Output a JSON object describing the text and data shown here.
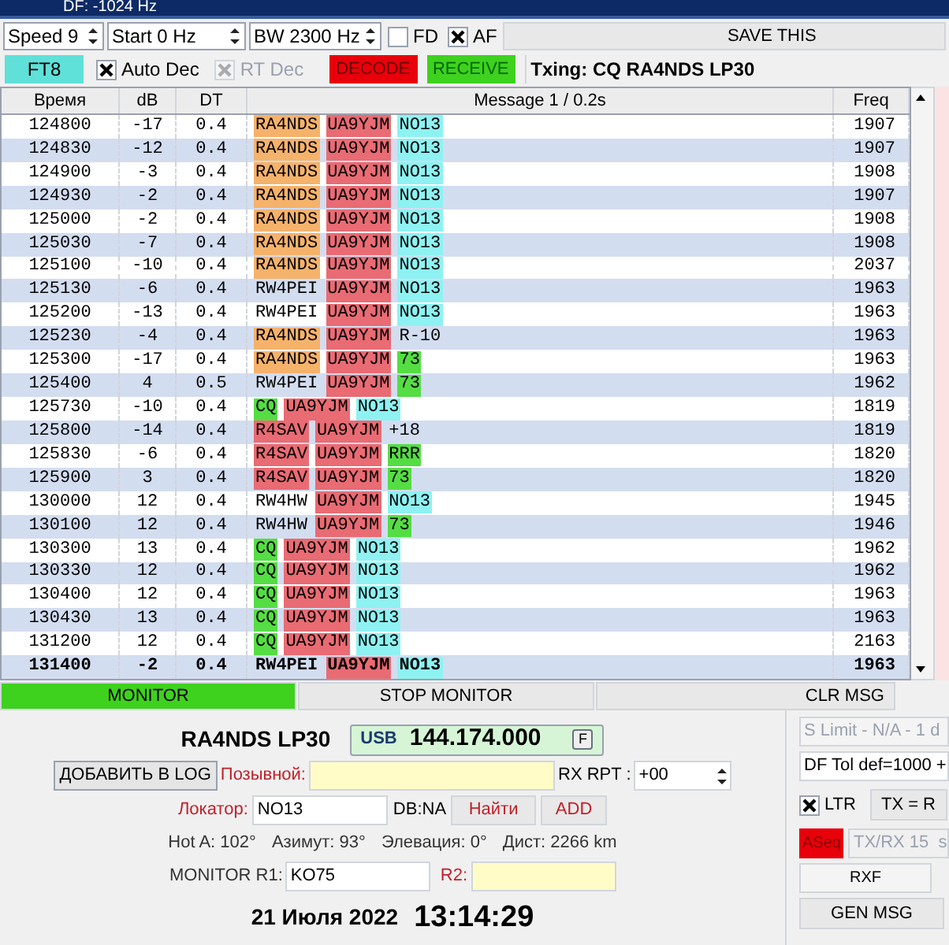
{
  "top_bar": {
    "readout": "DF: -1024 Hz"
  },
  "toolbar": {
    "spinners": [
      "Speed 9",
      "Start 0 Hz",
      "BW 2300 Hz"
    ],
    "checks": [
      {
        "label": "FD",
        "checked": false
      },
      {
        "label": "AF",
        "checked": true
      }
    ],
    "save_button": "SAVE THIS"
  },
  "mode_bar": {
    "mode_button": "FT8",
    "checks": [
      {
        "label": "Auto Dec",
        "checked": true,
        "disabled": false
      },
      {
        "label": "RT Dec",
        "checked": true,
        "disabled": true
      }
    ],
    "decode_button": "DECODE",
    "receive_button": "RECEIVE",
    "txing": "Txing: CQ RA4NDS LP30"
  },
  "table": {
    "columns": [
      "Время",
      "dB",
      "DT",
      "Message 1 / 0.2s",
      "Freq"
    ],
    "rows": [
      {
        "time": "124800",
        "db": "-17",
        "dt": "0.4",
        "message": [
          {
            "text": "RA4NDS",
            "color": "#f5b26b"
          },
          {
            "text": "UA9YJM",
            "color": "#e96b73"
          },
          {
            "text": "NO13",
            "color": "#8ef2f2"
          }
        ],
        "freq": "1907",
        "selected": false
      },
      {
        "time": "124830",
        "db": "-12",
        "dt": "0.4",
        "message": [
          {
            "text": "RA4NDS",
            "color": "#f5b26b"
          },
          {
            "text": "UA9YJM",
            "color": "#e96b73"
          },
          {
            "text": "NO13",
            "color": "#8ef2f2"
          }
        ],
        "freq": "1907",
        "selected": false
      },
      {
        "time": "124900",
        "db": "-3",
        "dt": "0.4",
        "message": [
          {
            "text": "RA4NDS",
            "color": "#f5b26b"
          },
          {
            "text": "UA9YJM",
            "color": "#e96b73"
          },
          {
            "text": "NO13",
            "color": "#8ef2f2"
          }
        ],
        "freq": "1908",
        "selected": false
      },
      {
        "time": "124930",
        "db": "-2",
        "dt": "0.4",
        "message": [
          {
            "text": "RA4NDS",
            "color": "#f5b26b"
          },
          {
            "text": "UA9YJM",
            "color": "#e96b73"
          },
          {
            "text": "NO13",
            "color": "#8ef2f2"
          }
        ],
        "freq": "1907",
        "selected": false
      },
      {
        "time": "125000",
        "db": "-2",
        "dt": "0.4",
        "message": [
          {
            "text": "RA4NDS",
            "color": "#f5b26b"
          },
          {
            "text": "UA9YJM",
            "color": "#e96b73"
          },
          {
            "text": "NO13",
            "color": "#8ef2f2"
          }
        ],
        "freq": "1908",
        "selected": false
      },
      {
        "time": "125030",
        "db": "-7",
        "dt": "0.4",
        "message": [
          {
            "text": "RA4NDS",
            "color": "#f5b26b"
          },
          {
            "text": "UA9YJM",
            "color": "#e96b73"
          },
          {
            "text": "NO13",
            "color": "#8ef2f2"
          }
        ],
        "freq": "1908",
        "selected": false
      },
      {
        "time": "125100",
        "db": "-10",
        "dt": "0.4",
        "message": [
          {
            "text": "RA4NDS",
            "color": "#f5b26b"
          },
          {
            "text": "UA9YJM",
            "color": "#e96b73"
          },
          {
            "text": "NO13",
            "color": "#8ef2f2"
          }
        ],
        "freq": "2037",
        "selected": false
      },
      {
        "time": "125130",
        "db": "-6",
        "dt": "0.4",
        "message": [
          {
            "text": "RW4PEI"
          },
          {
            "text": "UA9YJM",
            "color": "#e96b73"
          },
          {
            "text": "NO13",
            "color": "#8ef2f2"
          }
        ],
        "freq": "1963",
        "selected": false
      },
      {
        "time": "125200",
        "db": "-13",
        "dt": "0.4",
        "message": [
          {
            "text": "RW4PEI"
          },
          {
            "text": "UA9YJM",
            "color": "#e96b73"
          },
          {
            "text": "NO13",
            "color": "#8ef2f2"
          }
        ],
        "freq": "1963",
        "selected": false
      },
      {
        "time": "125230",
        "db": "-4",
        "dt": "0.4",
        "message": [
          {
            "text": "RA4NDS",
            "color": "#f5b26b"
          },
          {
            "text": "UA9YJM",
            "color": "#e96b73"
          },
          {
            "text": "R-10"
          }
        ],
        "freq": "1963",
        "selected": false
      },
      {
        "time": "125300",
        "db": "-17",
        "dt": "0.4",
        "message": [
          {
            "text": "RA4NDS",
            "color": "#f5b26b"
          },
          {
            "text": "UA9YJM",
            "color": "#e96b73"
          },
          {
            "text": "73",
            "color": "#55dd44"
          }
        ],
        "freq": "1963",
        "selected": false
      },
      {
        "time": "125400",
        "db": "4",
        "dt": "0.5",
        "message": [
          {
            "text": "RW4PEI"
          },
          {
            "text": "UA9YJM",
            "color": "#e96b73"
          },
          {
            "text": "73",
            "color": "#55dd44"
          }
        ],
        "freq": "1962",
        "selected": false
      },
      {
        "time": "125730",
        "db": "-10",
        "dt": "0.4",
        "message": [
          {
            "text": "CQ",
            "color": "#55dd44"
          },
          {
            "text": "UA9YJM",
            "color": "#e96b73"
          },
          {
            "text": "NO13",
            "color": "#8ef2f2"
          }
        ],
        "freq": "1819",
        "selected": false
      },
      {
        "time": "125800",
        "db": "-14",
        "dt": "0.4",
        "message": [
          {
            "text": "R4SAV",
            "color": "#e96b73"
          },
          {
            "text": "UA9YJM",
            "color": "#e96b73"
          },
          {
            "text": "+18"
          }
        ],
        "freq": "1819",
        "selected": false
      },
      {
        "time": "125830",
        "db": "-6",
        "dt": "0.4",
        "message": [
          {
            "text": "R4SAV",
            "color": "#e96b73"
          },
          {
            "text": "UA9YJM",
            "color": "#e96b73"
          },
          {
            "text": "RRR",
            "color": "#55dd44"
          }
        ],
        "freq": "1820",
        "selected": false
      },
      {
        "time": "125900",
        "db": "3",
        "dt": "0.4",
        "message": [
          {
            "text": "R4SAV",
            "color": "#e96b73"
          },
          {
            "text": "UA9YJM",
            "color": "#e96b73"
          },
          {
            "text": "73",
            "color": "#55dd44"
          }
        ],
        "freq": "1820",
        "selected": false
      },
      {
        "time": "130000",
        "db": "12",
        "dt": "0.4",
        "message": [
          {
            "text": "RW4HW"
          },
          {
            "text": "UA9YJM",
            "color": "#e96b73"
          },
          {
            "text": "NO13",
            "color": "#8ef2f2"
          }
        ],
        "freq": "1945",
        "selected": false
      },
      {
        "time": "130100",
        "db": "12",
        "dt": "0.4",
        "message": [
          {
            "text": "RW4HW"
          },
          {
            "text": "UA9YJM",
            "color": "#e96b73"
          },
          {
            "text": "73",
            "color": "#55dd44"
          }
        ],
        "freq": "1946",
        "selected": false
      },
      {
        "time": "130300",
        "db": "13",
        "dt": "0.4",
        "message": [
          {
            "text": "CQ",
            "color": "#55dd44"
          },
          {
            "text": "UA9YJM",
            "color": "#e96b73"
          },
          {
            "text": "NO13",
            "color": "#8ef2f2"
          }
        ],
        "freq": "1962",
        "selected": false
      },
      {
        "time": "130330",
        "db": "12",
        "dt": "0.4",
        "message": [
          {
            "text": "CQ",
            "color": "#55dd44"
          },
          {
            "text": "UA9YJM",
            "color": "#e96b73"
          },
          {
            "text": "NO13",
            "color": "#8ef2f2"
          }
        ],
        "freq": "1962",
        "selected": false
      },
      {
        "time": "130400",
        "db": "12",
        "dt": "0.4",
        "message": [
          {
            "text": "CQ",
            "color": "#55dd44"
          },
          {
            "text": "UA9YJM",
            "color": "#e96b73"
          },
          {
            "text": "NO13",
            "color": "#8ef2f2"
          }
        ],
        "freq": "1963",
        "selected": false
      },
      {
        "time": "130430",
        "db": "13",
        "dt": "0.4",
        "message": [
          {
            "text": "CQ",
            "color": "#55dd44"
          },
          {
            "text": "UA9YJM",
            "color": "#e96b73"
          },
          {
            "text": "NO13",
            "color": "#8ef2f2"
          }
        ],
        "freq": "1963",
        "selected": false
      },
      {
        "time": "131200",
        "db": "12",
        "dt": "0.4",
        "message": [
          {
            "text": "CQ",
            "color": "#55dd44"
          },
          {
            "text": "UA9YJM",
            "color": "#e96b73"
          },
          {
            "text": "NO13",
            "color": "#8ef2f2"
          }
        ],
        "freq": "2163",
        "selected": false
      },
      {
        "time": "131400",
        "db": "-2",
        "dt": "0.4",
        "message": [
          {
            "text": "RW4PEI"
          },
          {
            "text": "UA9YJM",
            "color": "#e96b73"
          },
          {
            "text": "NO13",
            "color": "#8ef2f2"
          }
        ],
        "freq": "1963",
        "selected": true
      }
    ]
  },
  "monitor_buttons": [
    {
      "label": "MONITOR",
      "on": true
    },
    {
      "label": "STOP MONITOR",
      "on": false
    },
    {
      "label": "CLR MSG",
      "on": false
    }
  ],
  "station": {
    "title": "RA4NDS LP30",
    "mode": "USB",
    "frequency": "144.174.000",
    "f_button": "F",
    "add_log_button": "ДОБАВИТЬ В LOG",
    "callsign_label": "Позывной:",
    "rx_rpt_label": "RX RPT :",
    "rx_rpt_value": "+00",
    "locator_label": "Локатор:",
    "locator_value": "NO13",
    "db_label": "DB:NA",
    "find_button": "Найти",
    "add_button": "ADD",
    "info": [
      "Hot A: 102°",
      "Азимут: 93°",
      "Элевация: 0°",
      "Дист: 2266 km"
    ],
    "monitor_label": "MONITOR R1:",
    "monitor_value": "KO75",
    "r2_label": "R2:",
    "date": "21 Июля 2022",
    "time": "13:14:29"
  },
  "side_panel": {
    "s_limit": "S Limit - N/A - 1 d",
    "df_tol": "DF Tol def=1000 +",
    "ltr": {
      "label": "LTR",
      "checked": true
    },
    "tx_button": "TX = R",
    "aseq": {
      "label": "ASeq",
      "on": true
    },
    "txrx": "TX/RX 15  s",
    "rxf": "RXF",
    "gen_msg": "GEN MSG"
  }
}
